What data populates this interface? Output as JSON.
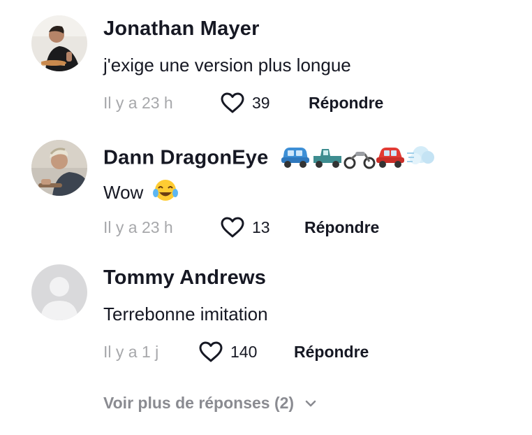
{
  "comments": [
    {
      "author": "Jonathan Mayer",
      "text": "j'exige une version plus longue",
      "time": "Il y a 23 h",
      "likes": "39",
      "reply_label": "Répondre",
      "avatar": "photo-chef-plating-icon"
    },
    {
      "author": "Dann DragonEye",
      "author_emojis": [
        "blue-car-icon",
        "pickup-truck-icon",
        "motorcycle-icon",
        "red-car-icon",
        "dash-cloud-icon"
      ],
      "text": "Wow",
      "text_emoji": "tears-of-joy-icon",
      "time": "Il y a 23 h",
      "likes": "13",
      "reply_label": "Répondre",
      "avatar": "photo-chef-cooking-icon"
    },
    {
      "author": "Tommy Andrews",
      "text": "Terrebonne imitation",
      "time": "Il y a 1 j",
      "likes": "140",
      "reply_label": "Répondre",
      "avatar": "default-user-icon"
    }
  ],
  "more_replies": {
    "label": "Voir plus de réponses (2)",
    "icon": "chevron-down-icon"
  },
  "colors": {
    "text": "#161823",
    "muted": "#a7a8ab",
    "more": "#8a8b91",
    "placeholder_avatar": "#d9d9db"
  }
}
